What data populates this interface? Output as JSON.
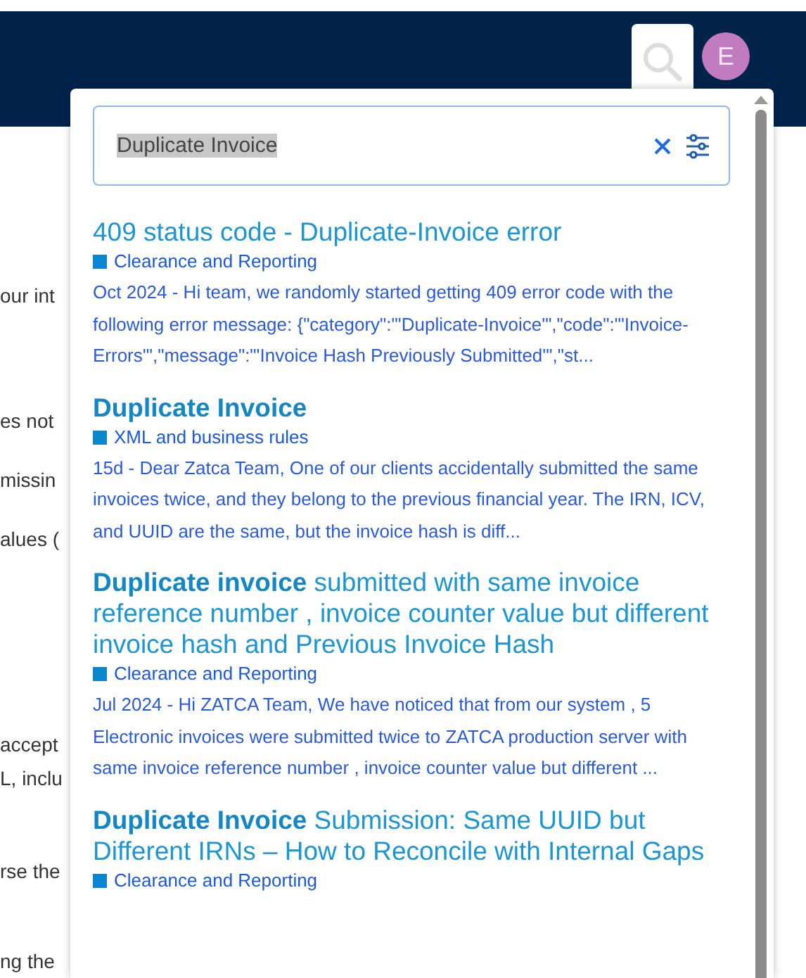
{
  "header": {
    "avatar_initial": "E"
  },
  "background_text": [
    "our int",
    "es not",
    "missin",
    "alues (",
    "accept",
    "L, inclu",
    "rse the",
    "ng the"
  ],
  "search": {
    "value": "Duplicate Invoice",
    "selected_text": true
  },
  "results": [
    {
      "title": "409 status code - Duplicate-Invoice error",
      "category": "Clearance and Reporting",
      "excerpt": "Oct 2024 - Hi team, we randomly started getting 409 error code with the following error message: {\"category\":\"'Duplicate-Invoice'\",\"code\":\"'Invoice-Errors'\",\"message\":\"'Invoice Hash Previously Submitted'\",\"st..."
    },
    {
      "title": "**Duplicate Invoice**",
      "category": "XML and business rules",
      "excerpt": "15d - Dear Zatca Team, One of our clients accidentally submitted the same invoices twice, and they belong to the previous financial year. The IRN, ICV, and UUID are the same, but the invoice hash is diff..."
    },
    {
      "title": "**Duplicate invoice** submitted with same invoice reference number , invoice counter value but different invoice hash and Previous Invoice Hash",
      "category": "Clearance and Reporting",
      "excerpt": "Jul 2024 - Hi ZATCA Team, We have noticed that from our system , 5 Electronic invoices were submitted twice to ZATCA production server with same invoice reference number , invoice counter value but different ..."
    },
    {
      "title": "**Duplicate Invoice** Submission: Same UUID but Different IRNs – How to Reconcile with Internal Gaps",
      "category": "Clearance and Reporting"
    }
  ]
}
